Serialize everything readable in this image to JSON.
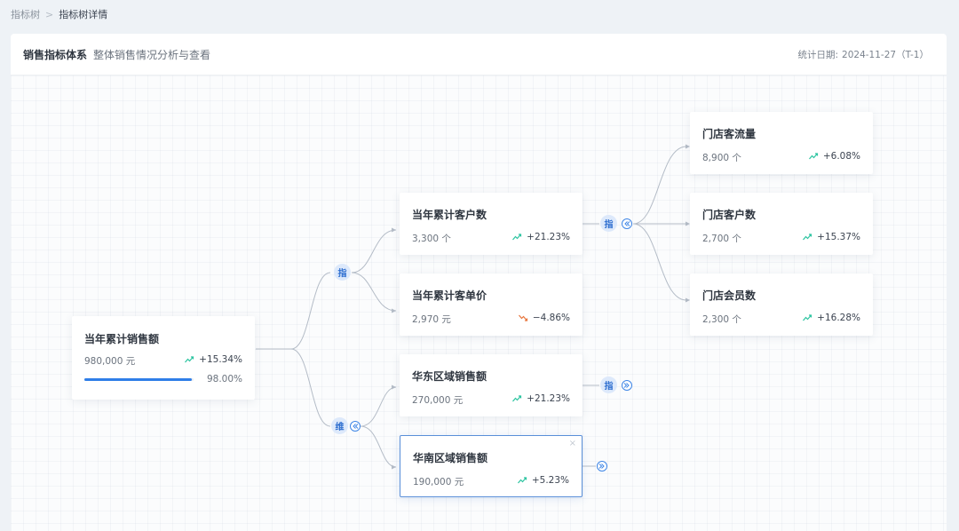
{
  "breadcrumb": {
    "parent": "指标树",
    "current": "指标树详情"
  },
  "header": {
    "title": "销售指标体系",
    "subtitle": "整体销售情况分析与查看",
    "date_label": "统计日期:",
    "date_value": "2024-11-27（T-1）"
  },
  "nodes": {
    "root": {
      "name": "当年累计销售额",
      "value": "980,000 元",
      "change": "+15.34%",
      "trend": "up",
      "progress_text": "98.00%",
      "progress": 0.98
    },
    "customers": {
      "name": "当年累计客户数",
      "value": "3,300 个",
      "change": "+21.23%",
      "trend": "up"
    },
    "unit_price": {
      "name": "当年累计客单价",
      "value": "2,970 元",
      "change": "−4.86%",
      "trend": "down"
    },
    "east": {
      "name": "华东区域销售额",
      "value": "270,000 元",
      "change": "+21.23%",
      "trend": "up"
    },
    "south": {
      "name": "华南区域销售额",
      "value": "190,000 元",
      "change": "+5.23%",
      "trend": "up"
    },
    "traffic": {
      "name": "门店客流量",
      "value": "8,900 个",
      "change": "+6.08%",
      "trend": "up"
    },
    "store_customers": {
      "name": "门店客户数",
      "value": "2,700 个",
      "change": "+15.37%",
      "trend": "up"
    },
    "members": {
      "name": "门店会员数",
      "value": "2,300 个",
      "change": "+16.28%",
      "trend": "up"
    }
  },
  "badges": {
    "indicator": "指",
    "dimension": "维"
  },
  "colors": {
    "up": "#2bc4a0",
    "down": "#e8743b",
    "accent": "#2f7ee8",
    "selected_border": "#5a8fd8"
  }
}
